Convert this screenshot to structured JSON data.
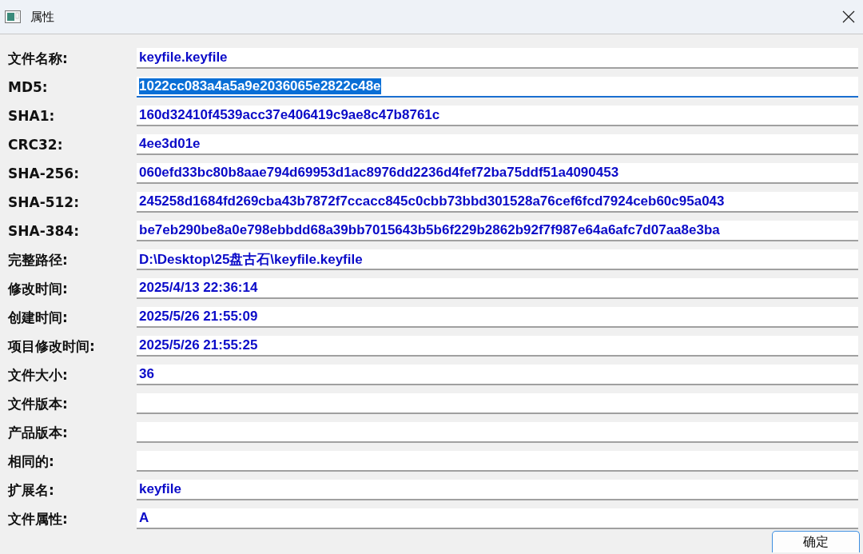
{
  "window": {
    "title": "属性"
  },
  "fields": [
    {
      "label": "文件名称:",
      "value": "keyfile.keyfile",
      "selected": false
    },
    {
      "label": "MD5:",
      "value": "1022cc083a4a5a9e2036065e2822c48e",
      "selected": true
    },
    {
      "label": "SHA1:",
      "value": "160d32410f4539acc37e406419c9ae8c47b8761c",
      "selected": false
    },
    {
      "label": "CRC32:",
      "value": "4ee3d01e",
      "selected": false
    },
    {
      "label": "SHA-256:",
      "value": "060efd33bc80b8aae794d69953d1ac8976dd2236d4fef72ba75ddf51a4090453",
      "selected": false
    },
    {
      "label": "SHA-512:",
      "value": "245258d1684fd269cba43b7872f7ccacc845c0cbb73bbd301528a76cef6fcd7924ceb60c95a043",
      "selected": false
    },
    {
      "label": "SHA-384:",
      "value": "be7eb290be8a0e798ebbdd68a39bb7015643b5b6f229b2862b92f7f987e64a6afc7d07aa8e3ba",
      "selected": false
    },
    {
      "label": "完整路径:",
      "value": "D:\\Desktop\\25盘古石\\keyfile.keyfile",
      "selected": false
    },
    {
      "label": "修改时间:",
      "value": "2025/4/13 22:36:14",
      "selected": false
    },
    {
      "label": "创建时间:",
      "value": "2025/5/26 21:55:09",
      "selected": false
    },
    {
      "label": "项目修改时间:",
      "value": "2025/5/26 21:55:25",
      "selected": false
    },
    {
      "label": "文件大小:",
      "value": "36",
      "selected": false
    },
    {
      "label": "文件版本:",
      "selected": false
    },
    {
      "label": "产品版本:",
      "selected": false
    },
    {
      "label": "相同的:",
      "selected": false
    },
    {
      "label": "扩展名:",
      "value": "keyfile",
      "selected": false
    },
    {
      "label": "文件属性:",
      "value": "A",
      "selected": false
    }
  ],
  "buttons": [
    "确定"
  ]
}
